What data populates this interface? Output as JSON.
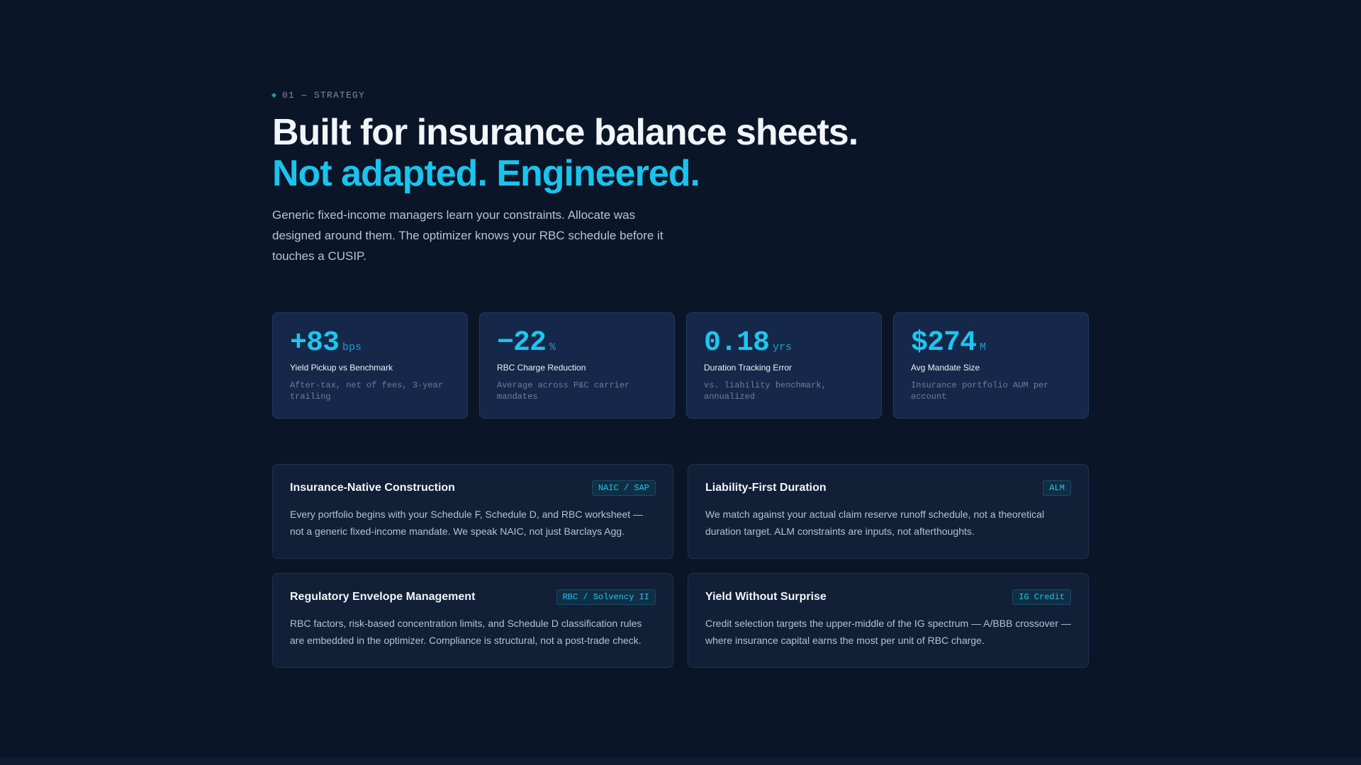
{
  "section": {
    "eyebrow": "01 — STRATEGY",
    "headline_line1": "Built for insurance balance sheets.",
    "headline_line2": "Not adapted. Engineered.",
    "intro": "Generic fixed-income managers learn your constraints. Allocate was designed around them. The optimizer knows your RBC schedule before it touches a CUSIP."
  },
  "stats": [
    {
      "value": "+83",
      "unit": "bps",
      "label": "Yield Pickup vs Benchmark",
      "sub": "After-tax, net of fees, 3-year trailing"
    },
    {
      "value": "−22",
      "unit": "%",
      "label": "RBC Charge Reduction",
      "sub": "Average across P&C carrier mandates"
    },
    {
      "value": "0.18",
      "unit": "yrs",
      "label": "Duration Tracking Error",
      "sub": "vs. liability benchmark, annualized"
    },
    {
      "value": "$274",
      "unit": "M",
      "label": "Avg Mandate Size",
      "sub": "Insurance portfolio AUM per account"
    }
  ],
  "features": [
    {
      "title": "Insurance-Native Construction",
      "tag": "NAIC / SAP",
      "body": "Every portfolio begins with your Schedule F, Schedule D, and RBC worksheet — not a generic fixed-income mandate. We speak NAIC, not just Barclays Agg."
    },
    {
      "title": "Liability-First Duration",
      "tag": "ALM",
      "body": "We match against your actual claim reserve runoff schedule, not a theoretical duration target. ALM constraints are inputs, not afterthoughts."
    },
    {
      "title": "Regulatory Envelope Management",
      "tag": "RBC / Solvency II",
      "body": "RBC factors, risk-based concentration limits, and Schedule D classification rules are embedded in the optimizer. Compliance is structural, not a post-trade check."
    },
    {
      "title": "Yield Without Surprise",
      "tag": "IG Credit",
      "body": "Credit selection targets the upper-middle of the IG spectrum — A/BBB crossover — where insurance capital earns the most per unit of RBC charge."
    }
  ],
  "colors": {
    "background": "#0a1628",
    "accent": "#19c4ee",
    "stat_card": "#15284a",
    "feature_card": "#111f37"
  },
  "icons": {
    "eyebrow_marker": "diamond-icon"
  }
}
